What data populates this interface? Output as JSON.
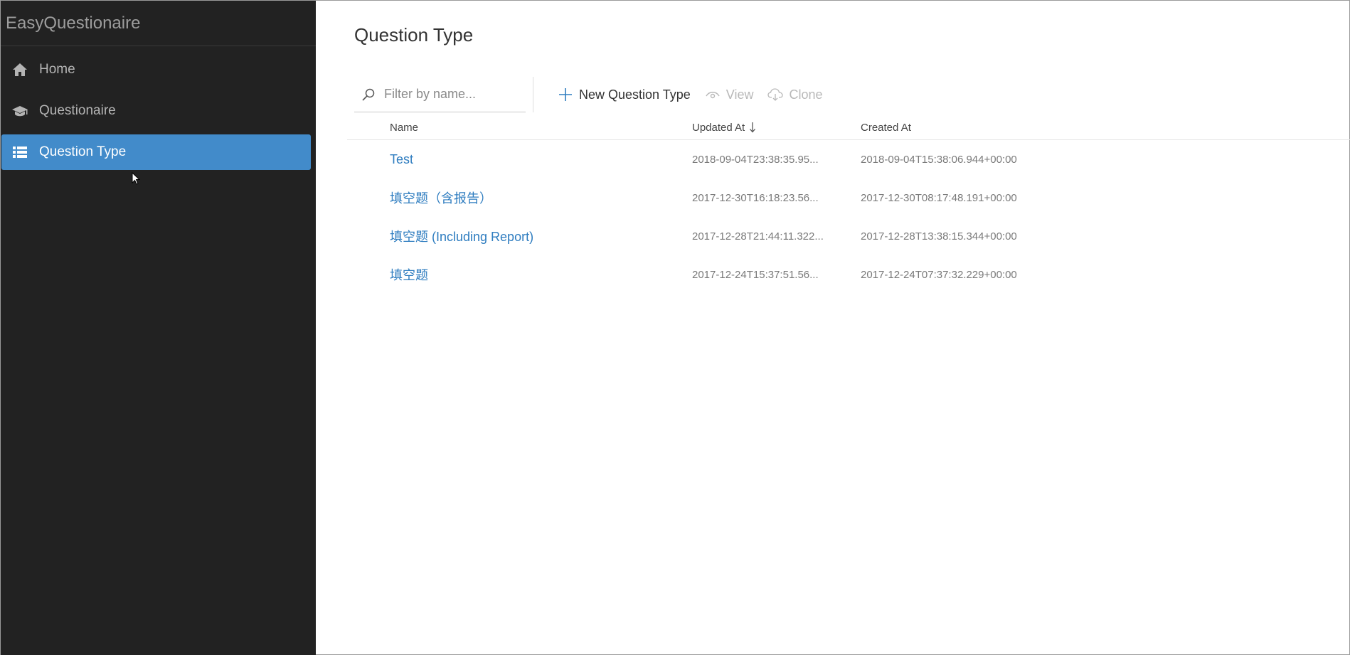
{
  "app": {
    "title": "EasyQuestionaire"
  },
  "sidebar": {
    "items": [
      {
        "label": "Home",
        "icon": "home-icon",
        "active": false
      },
      {
        "label": "Questionaire",
        "icon": "graduation-cap-icon",
        "active": false
      },
      {
        "label": "Question Type",
        "icon": "list-icon",
        "active": true
      }
    ]
  },
  "page": {
    "title": "Question Type"
  },
  "toolbar": {
    "search_placeholder": "Filter by name...",
    "new_label": "New Question Type",
    "view_label": "View",
    "clone_label": "Clone"
  },
  "table": {
    "columns": {
      "name": "Name",
      "updated": "Updated At",
      "created": "Created At"
    },
    "sort": {
      "column": "updated",
      "direction": "descending"
    },
    "rows": [
      {
        "name": "Test",
        "updated": "2018-09-04T23:38:35.95...",
        "created": "2018-09-04T15:38:06.944+00:00"
      },
      {
        "name": "填空题（含报告）",
        "updated": "2017-12-30T16:18:23.56...",
        "created": "2017-12-30T08:17:48.191+00:00"
      },
      {
        "name": "填空题 (Including Report)",
        "updated": "2017-12-28T21:44:11.322...",
        "created": "2017-12-28T13:38:15.344+00:00"
      },
      {
        "name": "填空题",
        "updated": "2017-12-24T15:37:51.56...",
        "created": "2017-12-24T07:37:32.229+00:00"
      }
    ]
  },
  "colors": {
    "sidebar_bg": "#222222",
    "accent": "#428bca",
    "link": "#2f7dc0"
  }
}
